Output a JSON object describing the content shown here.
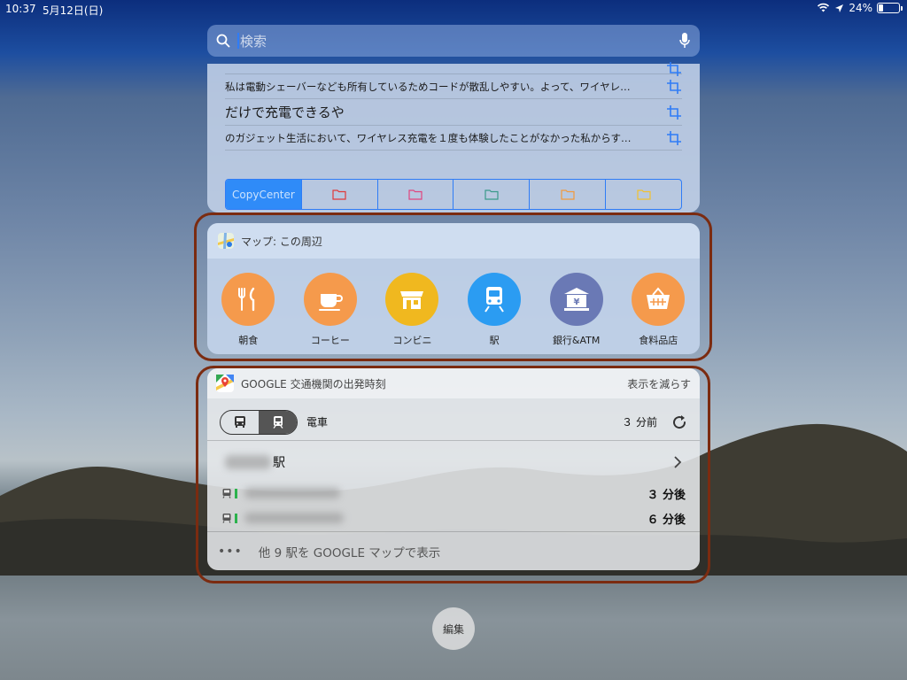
{
  "status_bar": {
    "time": "10:37",
    "date": "5月12日(日)",
    "battery": "24%",
    "battery_level": 0.24
  },
  "search": {
    "placeholder": "検索",
    "mic_icon": "microphone-icon"
  },
  "copy_center": {
    "items": [
      {
        "text": "私は電動シェーバーなども所有しているためコードが散乱しやすい。よって、ワイヤレ…"
      },
      {
        "text": "だけで充電できるや"
      },
      {
        "text": "のガジェット生活において、ワイヤレス充電を１度も体験したことがなかった私からす…"
      }
    ],
    "tabs": [
      "CopyCenter"
    ],
    "folder_colors": [
      "#e03a3a",
      "#e0457e",
      "#3a9a8a",
      "#f19a3e",
      "#f2c12e"
    ]
  },
  "maps": {
    "title": "マップ: この周辺",
    "categories": [
      {
        "label": "朝食",
        "icon": "fork-knife-icon",
        "color": "#f59a4c"
      },
      {
        "label": "コーヒー",
        "icon": "coffee-cup-icon",
        "color": "#f59a4c"
      },
      {
        "label": "コンビニ",
        "icon": "store-icon",
        "color": "#f0b81f"
      },
      {
        "label": "駅",
        "icon": "train-icon",
        "color": "#2b9cf2"
      },
      {
        "label": "銀行&ATM",
        "icon": "bank-icon",
        "color": "#6a79b5"
      },
      {
        "label": "食料品店",
        "icon": "basket-icon",
        "color": "#f59a4c"
      }
    ]
  },
  "transit": {
    "title": "GOOGLE 交通機関の出発時刻",
    "show_less": "表示を減らす",
    "mode_label": "電車",
    "updated": "３ 分前",
    "station_suffix": "駅",
    "departures": [
      {
        "time": "３ 分後"
      },
      {
        "time": "６ 分後"
      }
    ],
    "more": "他 9 駅を GOOGLE マップで表示"
  },
  "edit": {
    "label": "編集"
  }
}
